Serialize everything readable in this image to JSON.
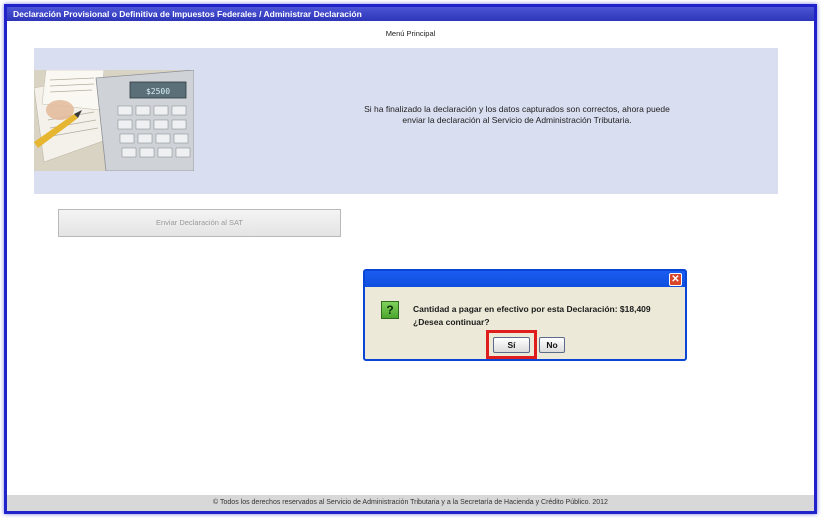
{
  "window": {
    "title": "Declaración Provisional o Definitiva de Impuestos Federales / Administrar Declaración"
  },
  "nav": {
    "menu_principal": "Menú Principal"
  },
  "info": {
    "message": "Si ha finalizado la declaración y los datos capturados son correctos, ahora puede enviar la declaración al Servicio de Administración Tributaria.",
    "photo_display": "$2500"
  },
  "actions": {
    "send_label": "Enviar Declaración al SAT"
  },
  "dialog": {
    "close_glyph": "✕",
    "icon_glyph": "?",
    "line1": "Cantidad a pagar en efectivo por esta Declaración: $18,409",
    "line2": "¿Desea continuar?",
    "yes_label": "Sí",
    "no_label": "No",
    "highlight_color": "#e01d1d"
  },
  "footer": {
    "text": "© Todos los derechos reservados al Servicio de Administración Tributaria y a la Secretaría de Hacienda y Crédito Público. 2012"
  },
  "colors": {
    "frame": "#1f23c9",
    "panel": "#d9def0",
    "footer": "#d8d8d8"
  }
}
